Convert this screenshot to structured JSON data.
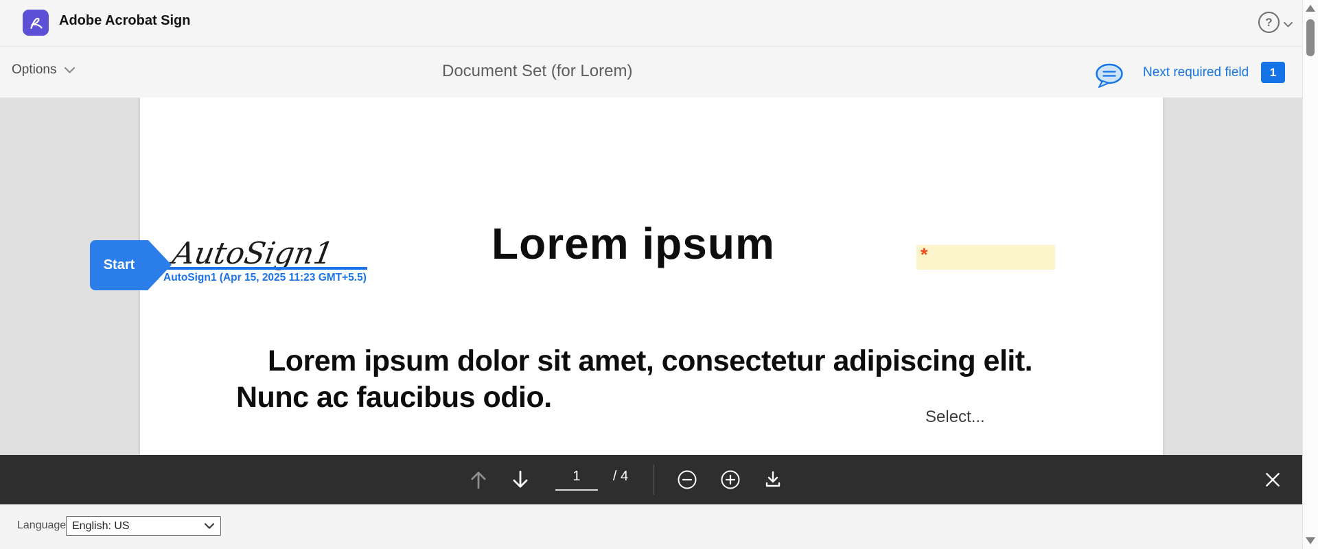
{
  "colors": {
    "accent_blue": "#1473e6",
    "start_tab_blue": "#2b7de9",
    "signature_blue": "#1a73e8",
    "field_yellow": "#fcf5cc",
    "required_red": "#f04a1d",
    "toolbar_dark": "#2e2e2e",
    "logo_purple": "#5b50d6"
  },
  "header": {
    "app_title": "Adobe Acrobat Sign",
    "help_glyph": "?"
  },
  "subheader": {
    "options_label": "Options",
    "document_title": "Document Set (for Lorem)",
    "next_required_label": "Next required field",
    "next_required_count": "1"
  },
  "document": {
    "start_tab_label": "Start",
    "signature_name": "AutoSign1",
    "signature_timestamp": "AutoSign1 (Apr 15, 2025 11:23 GMT+5.5)",
    "heading": "Lorem ipsum",
    "required_marker": "*",
    "body_text": "Lorem ipsum dolor sit amet, consectetur adipiscing elit. Nunc ac faucibus odio.",
    "select_placeholder": "Select..."
  },
  "pager": {
    "current_page": "1",
    "page_total_label": "/ 4"
  },
  "bottom_bar": {
    "language_label": "Language",
    "language_value": "English: US"
  }
}
